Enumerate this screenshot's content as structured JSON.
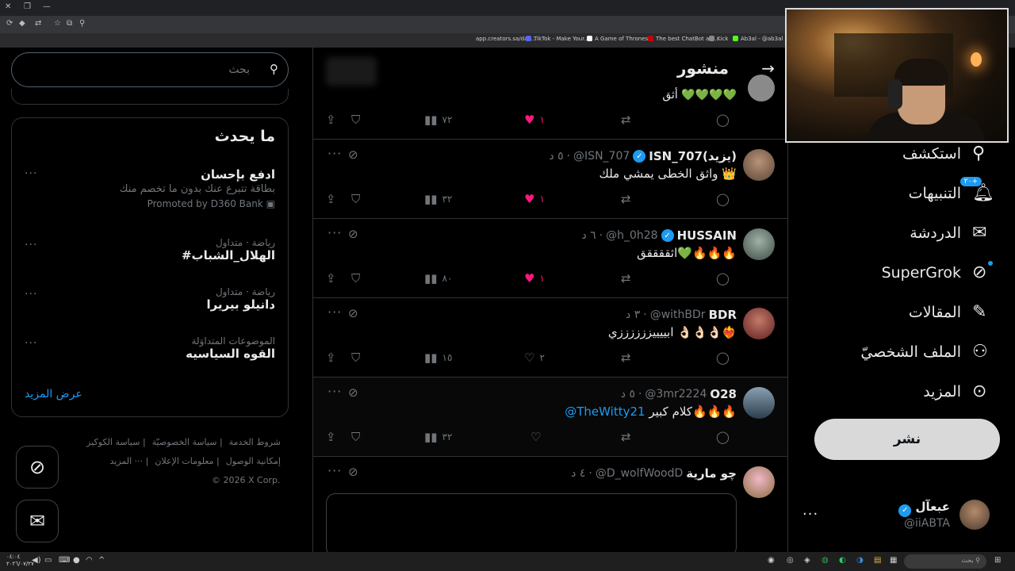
{
  "browser": {
    "bookmarks": [
      {
        "label": "app.creators.sa/das...",
        "color": "#5865f2"
      },
      {
        "label": "TikTok - Make Your...",
        "color": "#000000"
      },
      {
        "label": "A Game of Thrones...",
        "color": "#cc0000"
      },
      {
        "label": "The best ChatBot an...",
        "color": "#555555"
      },
      {
        "label": "Kick",
        "color": "#53fc18"
      },
      {
        "label": "Ab3al - @ab3al |...",
        "color": "#444444"
      }
    ]
  },
  "nav": {
    "explore": "استكشف",
    "notifications": "التنبيهات",
    "notifications_badge": "٢٠+",
    "chat": "الدردشة",
    "supergrok": "SuperGrok",
    "articles": "المقالات",
    "profile": "الملف الشخصيّ",
    "more": "المزيد",
    "post_button": "نشر"
  },
  "account": {
    "name": "عبعآل",
    "handle": "@iiABTA"
  },
  "feed": {
    "header_title": "منشور",
    "partial_text": "أثق 💚💚💚💚",
    "partial_views": "٧٢",
    "partial_likes": "١",
    "compose_placeholder": ""
  },
  "posts": [
    {
      "name": "ISN_707(يزيد)",
      "verified": true,
      "handle": "@ISN_707",
      "time": "٥ د",
      "text": "واثق الخطى يمشي ملك 👑",
      "mention": "",
      "views": "٣٢",
      "likes": "١",
      "liked": true,
      "avatar_color": "#8b6b52"
    },
    {
      "name": "HUSSAIN",
      "verified": true,
      "handle": "@h_0h28",
      "time": "٦ د",
      "text": "اثققققق💚🔥🔥🔥",
      "mention": "",
      "views": "٨٠",
      "likes": "١",
      "liked": true,
      "avatar_color": "#5d6f66"
    },
    {
      "name": "BDR",
      "verified": false,
      "handle": "@withBDr",
      "time": "٣ د",
      "text": "ابييييززززززي 👌🏻👌🏻👌🏻❤️‍🔥",
      "mention": "",
      "views": "١٥",
      "likes": "٢",
      "liked": false,
      "avatar_color": "#7a2b2b"
    },
    {
      "name": "O28",
      "verified": false,
      "handle": "@3mr2224",
      "time": "٥ د",
      "text": "كلام كبير🔥🔥🔥",
      "mention": "@TheWitty21",
      "views": "٣٢",
      "likes": "",
      "liked": false,
      "avatar_color": "#4e6a7e"
    },
    {
      "name": "چو مارية",
      "verified": false,
      "handle": "@D_wolfWoodD",
      "time": "٤ د",
      "text": "",
      "mention": "",
      "views": "",
      "likes": "",
      "liked": false,
      "avatar_color": "#c9a66b"
    }
  ],
  "search": {
    "placeholder": "بحث"
  },
  "trends": {
    "title": "ما يحدث",
    "items": [
      {
        "meta": "",
        "name": "ادفع بإحسان",
        "desc": "بطاقة تتبرع عنك بدون ما تخصم منك",
        "promo": "Promoted by D360 Bank"
      },
      {
        "meta": "رياضة · متداول",
        "name": "#الهلال_الشباب",
        "desc": "",
        "promo": ""
      },
      {
        "meta": "رياضة · متداول",
        "name": "دانيلو بيريرا",
        "desc": "",
        "promo": ""
      },
      {
        "meta": "الموضوعات المتداوَلة",
        "name": "القوه السياسيه",
        "desc": "",
        "promo": ""
      }
    ],
    "show_more": "عرض المزيد"
  },
  "footer": {
    "terms": "شروط الخدمة",
    "privacy": "سياسة الخصوصيّة",
    "cookies": "سياسة الكوكيز",
    "accessibility": "إمكانية الوصول",
    "ads": "معلومات الإعلان",
    "more": "··· المزيد",
    "copyright": "© 2026 X Corp."
  },
  "taskbar": {
    "search": "بحث",
    "clock_time": "٠٤:٠٤",
    "clock_date": "٢٠٢٦/٠٧/٢٧"
  }
}
